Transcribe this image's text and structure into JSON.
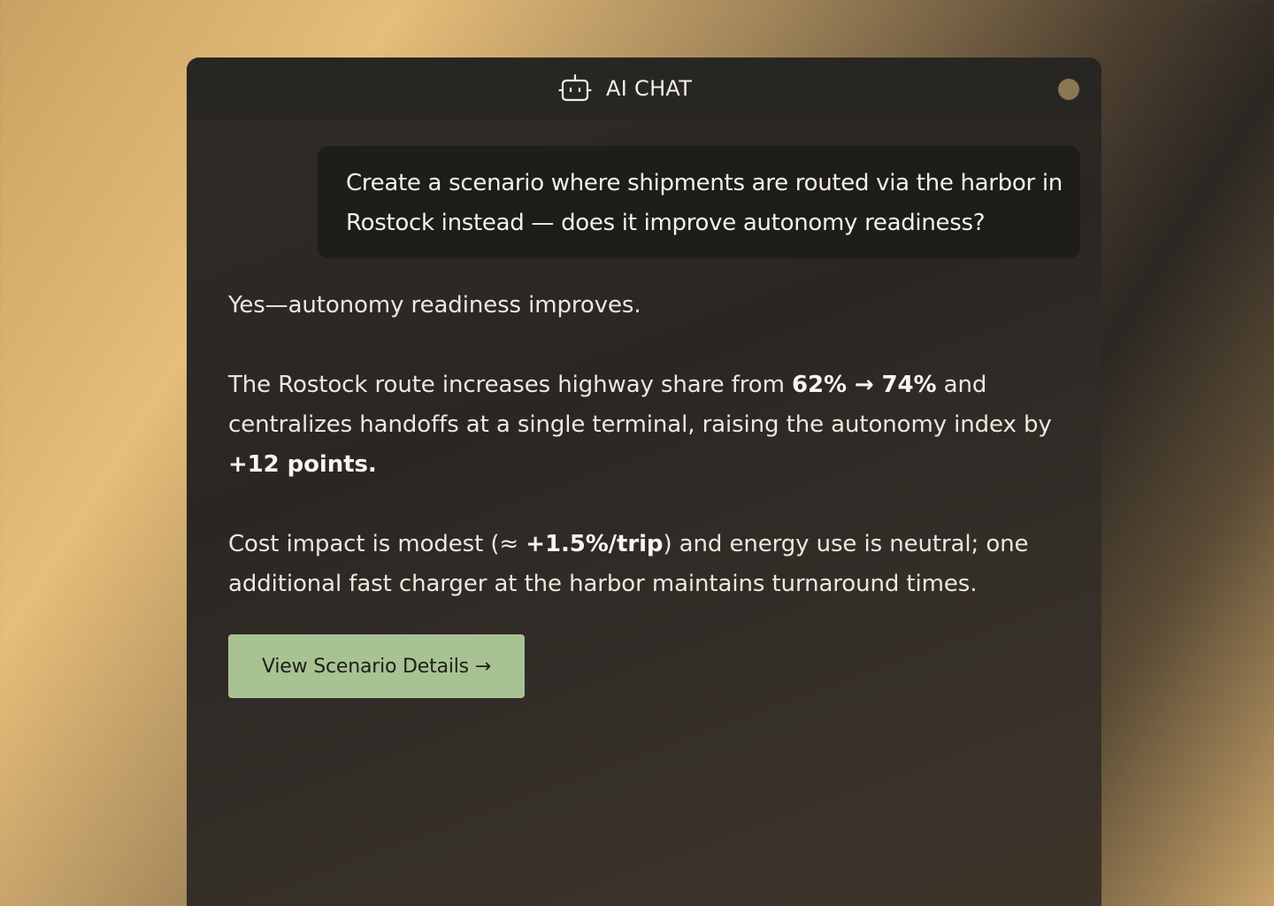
{
  "header": {
    "title": "AI CHAT",
    "icon": "robot-icon",
    "status_dot_color": "#8c7752"
  },
  "messages": {
    "user": {
      "text": "Create a scenario where shipments are routed via the harbor in Rostock instead — does it improve autonomy readiness?"
    },
    "assistant": {
      "summary": "Yes—autonomy readiness improves.",
      "p2_pre": "The Rostock route increases highway share from ",
      "p2_highway_share": "62% → 74%",
      "p2_mid": " and centralizes handoffs at a single terminal, raising the autonomy index by ",
      "p2_index_change": "+12 points.",
      "p3_pre": "Cost impact is modest (≈ ",
      "p3_cost": "+1.5%/trip",
      "p3_post": ") and energy use is neutral; one additional fast charger at the harbor maintains turnaround times."
    }
  },
  "actions": {
    "view_details_label": "View Scenario Details →"
  },
  "colors": {
    "button_bg": "#a9c293",
    "user_bubble_bg": "#1f1d1a",
    "header_bg": "#282622"
  }
}
